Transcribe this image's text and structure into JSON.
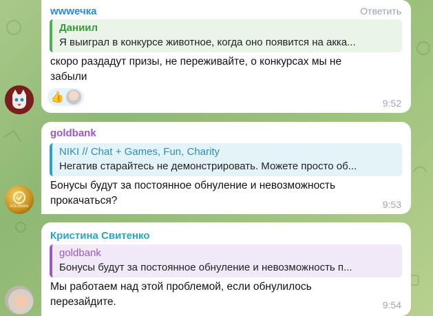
{
  "messages": [
    {
      "sender": "wwwечка",
      "reply_label": "Ответить",
      "quote": {
        "author": "Даниил",
        "text": "Я выиграл в конкурсе животное, когда оно появится на акка..."
      },
      "text_line1": "скоро раздадут призы, не переживайте, о конкурсах мы не",
      "text_line2": "забыли",
      "time": "9:52",
      "reaction_emoji": "👍",
      "avatar_icon": "cat-avatar-icon"
    },
    {
      "sender": "goldbank",
      "quote": {
        "author": "NIKI // Chat + Games, Fun, Charity",
        "text": "Негатив старайтесь не демонстрировать. Можете просто об..."
      },
      "text_line1": "Бонусы будут за постоянное обнуление и невозможность",
      "text_line2": "прокачаться?",
      "time": "9:53",
      "avatar_icon": "goldbank-logo-icon",
      "avatar_text": "GOLDBANK"
    },
    {
      "sender": "Кристина Свитенко",
      "quote": {
        "author": "goldbank",
        "text": "Бонусы будут за постоянное обнуление и невозможность п..."
      },
      "text_line1": "Мы работаем над этой проблемой, если обнулилось",
      "text_line2": "перезайдите.",
      "time": "9:54",
      "avatar_icon": "user-photo-avatar"
    }
  ],
  "colors": {
    "msg1_name": "#2d86d6",
    "msg1_quote": "#4caf50",
    "msg2_name": "#9a57c9",
    "msg2_quote": "#2aa3c6",
    "msg3_name": "#2aa3c6",
    "msg3_quote": "#9a57c9"
  }
}
